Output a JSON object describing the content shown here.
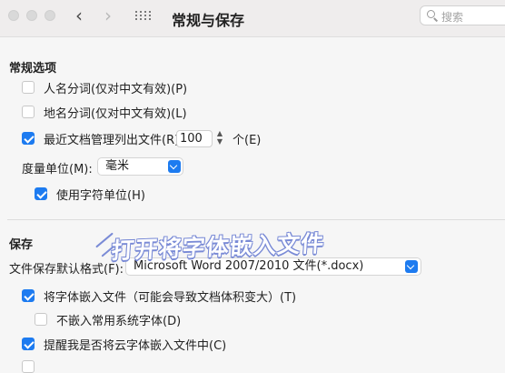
{
  "toolbar": {
    "title": "常规与保存",
    "back_glyph": "‹",
    "forward_glyph": "›",
    "search_placeholder": "搜索"
  },
  "general": {
    "section_title": "常规选项",
    "person_name_split": "人名分词(仅对中文有效)(P)",
    "place_name_split": "地名分词(仅对中文有效)(L)",
    "recent_docs_label": "最近文档管理列出文件(R):",
    "recent_docs_value": "100",
    "recent_docs_suffix": "个(E)",
    "unit_label": "度量单位(M):",
    "unit_value": "毫米",
    "char_unit": "使用字符单位(H)"
  },
  "save": {
    "section_title": "保存",
    "default_format_label": "文件保存默认格式(F):",
    "default_format_value": "Microsoft Word 2007/2010 文件(*.docx)",
    "embed_fonts": "将字体嵌入文件（可能会导致文档体积变大）(T)",
    "no_embed_common": "不嵌入常用系统字体(D)",
    "remind_cloud_fonts": "提醒我是否将云字体嵌入文件中(C)"
  },
  "watermark_text": "打开将字体嵌入文件",
  "colors": {
    "accent": "#1d7bf0",
    "watermark_stroke": "#7a8bd6"
  }
}
